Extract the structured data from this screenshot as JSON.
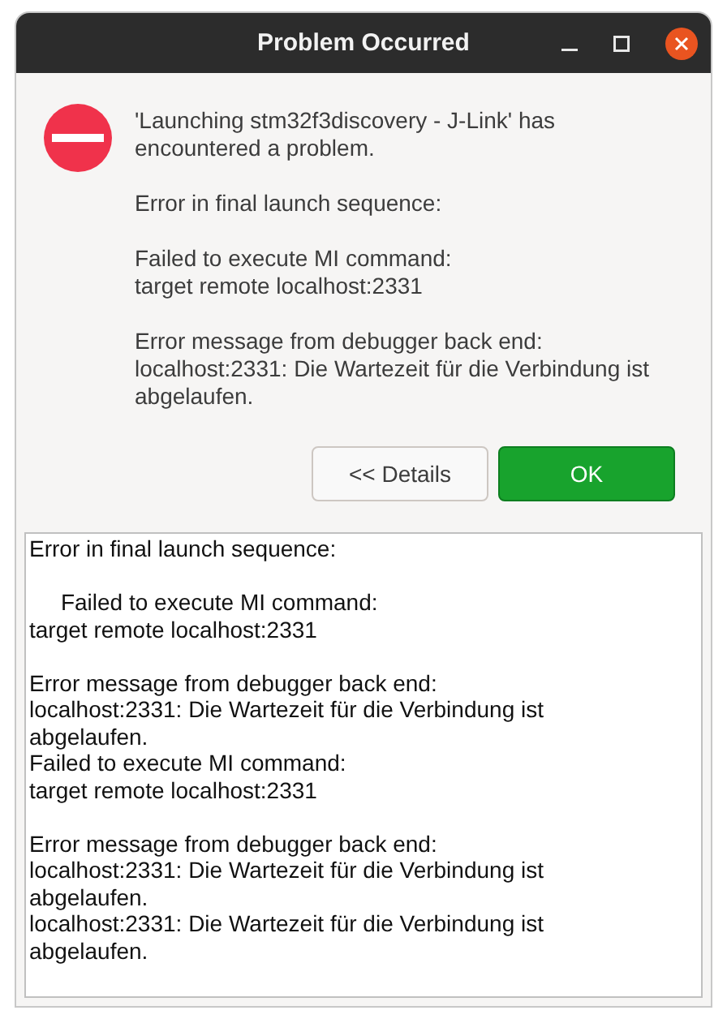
{
  "window": {
    "title": "Problem Occurred"
  },
  "message": {
    "summary": "'Launching stm32f3discovery - J-Link' has encountered a problem.",
    "paragraphs": [
      "Error in final launch sequence:",
      "Failed to execute MI command:\ntarget remote localhost:2331",
      "Error message from debugger back end:\nlocalhost:2331: Die Wartezeit für die Verbindung ist abgelaufen."
    ]
  },
  "buttons": [
    {
      "label": "<< Details",
      "kind": "normal"
    },
    {
      "label": "OK",
      "kind": "default"
    }
  ],
  "details": {
    "value": "Error in final launch sequence:\n\n     Failed to execute MI command:\ntarget remote localhost:2331\n\nError message from debugger back end:\nlocalhost:2331: Die Wartezeit für die Verbindung ist\nabgelaufen.\nFailed to execute MI command:\ntarget remote localhost:2331\n\nError message from debugger back end:\nlocalhost:2331: Die Wartezeit für die Verbindung ist\nabgelaufen.\nlocalhost:2331: Die Wartezeit für die Verbindung ist\nabgelaufen."
  }
}
